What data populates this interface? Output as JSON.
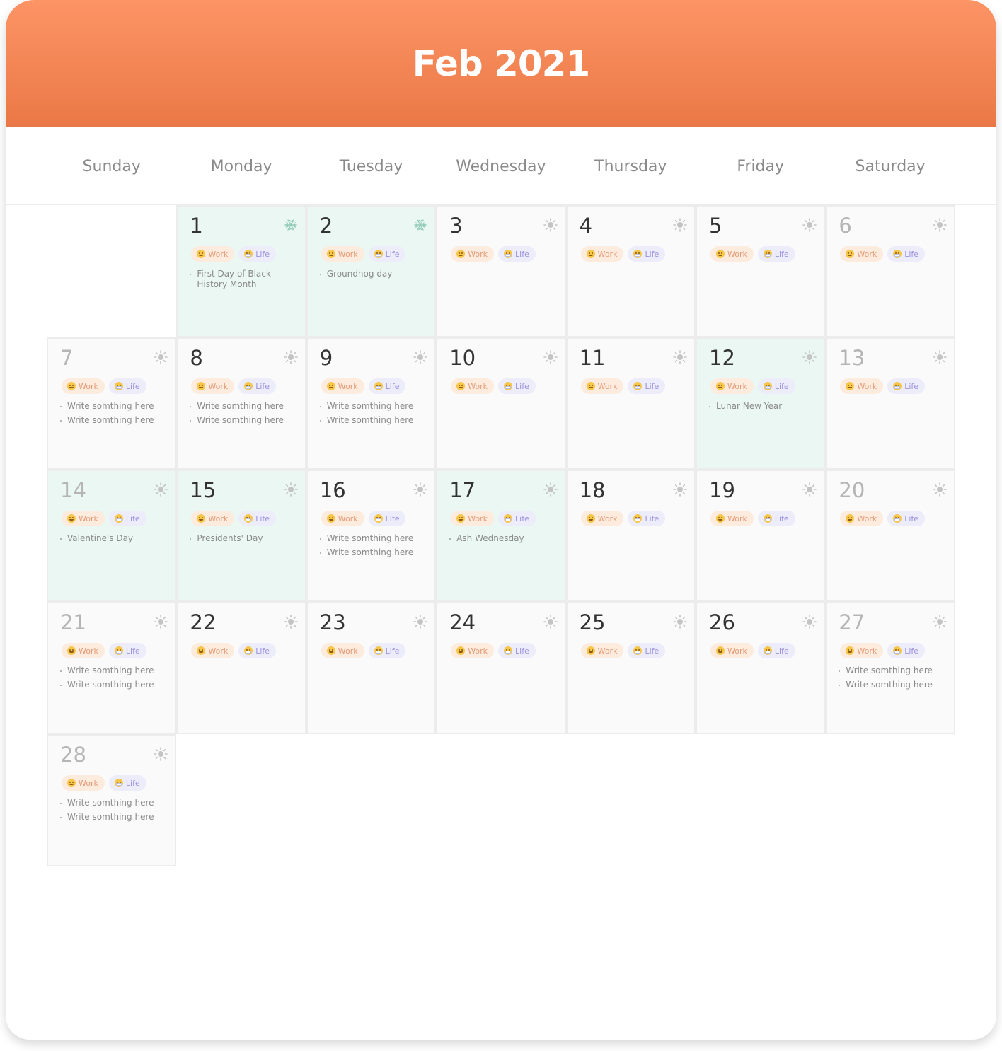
{
  "calendar": {
    "title": "Feb 2021",
    "weekdays": [
      "Sunday",
      "Monday",
      "Tuesday",
      "Wednesday",
      "Thursday",
      "Friday",
      "Saturday"
    ],
    "tags": {
      "work": "Work",
      "life": "Life"
    },
    "colors": {
      "header_top": "#fd9465",
      "header_bottom": "#ea7846",
      "holiday_bg": "#eaf7f2",
      "cell_bg": "#fafafa",
      "work_tag_bg": "#fdebdd",
      "life_tag_bg": "#ececfb"
    },
    "days": [
      {
        "day": "1",
        "weekday": 1,
        "week": 0,
        "holiday": true,
        "weather": "snowflake-icon",
        "notes": [
          "First Day of Black History Month"
        ]
      },
      {
        "day": "2",
        "weekday": 2,
        "week": 0,
        "holiday": true,
        "weather": "snowflake-icon",
        "notes": [
          "Groundhog day"
        ]
      },
      {
        "day": "3",
        "weekday": 3,
        "week": 0,
        "holiday": false,
        "weather": "sun-icon",
        "notes": []
      },
      {
        "day": "4",
        "weekday": 4,
        "week": 0,
        "holiday": false,
        "weather": "sun-icon",
        "notes": []
      },
      {
        "day": "5",
        "weekday": 5,
        "week": 0,
        "holiday": false,
        "weather": "sun-icon",
        "notes": []
      },
      {
        "day": "6",
        "weekday": 6,
        "week": 0,
        "holiday": false,
        "weather": "sun-icon",
        "notes": []
      },
      {
        "day": "7",
        "weekday": 0,
        "week": 1,
        "holiday": false,
        "weather": "sun-icon",
        "notes": [
          "Write somthing here",
          "Write somthing here"
        ]
      },
      {
        "day": "8",
        "weekday": 1,
        "week": 1,
        "holiday": false,
        "weather": "sun-icon",
        "notes": [
          "Write somthing here",
          "Write somthing here"
        ]
      },
      {
        "day": "9",
        "weekday": 2,
        "week": 1,
        "holiday": false,
        "weather": "sun-icon",
        "notes": [
          "Write somthing here",
          "Write somthing here"
        ]
      },
      {
        "day": "10",
        "weekday": 3,
        "week": 1,
        "holiday": false,
        "weather": "sun-icon",
        "notes": []
      },
      {
        "day": "11",
        "weekday": 4,
        "week": 1,
        "holiday": false,
        "weather": "sun-icon",
        "notes": []
      },
      {
        "day": "12",
        "weekday": 5,
        "week": 1,
        "holiday": true,
        "weather": "sun-icon",
        "notes": [
          "Lunar New Year"
        ]
      },
      {
        "day": "13",
        "weekday": 6,
        "week": 1,
        "holiday": false,
        "weather": "sun-icon",
        "notes": []
      },
      {
        "day": "14",
        "weekday": 0,
        "week": 2,
        "holiday": true,
        "weather": "sun-icon",
        "notes": [
          "Valentine's Day"
        ]
      },
      {
        "day": "15",
        "weekday": 1,
        "week": 2,
        "holiday": true,
        "weather": "sun-icon",
        "notes": [
          "Presidents' Day"
        ]
      },
      {
        "day": "16",
        "weekday": 2,
        "week": 2,
        "holiday": false,
        "weather": "sun-icon",
        "notes": [
          "Write somthing here",
          "Write somthing here"
        ]
      },
      {
        "day": "17",
        "weekday": 3,
        "week": 2,
        "holiday": true,
        "weather": "sun-icon",
        "notes": [
          "Ash Wednesday"
        ]
      },
      {
        "day": "18",
        "weekday": 4,
        "week": 2,
        "holiday": false,
        "weather": "sun-icon",
        "notes": []
      },
      {
        "day": "19",
        "weekday": 5,
        "week": 2,
        "holiday": false,
        "weather": "sun-icon",
        "notes": []
      },
      {
        "day": "20",
        "weekday": 6,
        "week": 2,
        "holiday": false,
        "weather": "sun-icon",
        "notes": []
      },
      {
        "day": "21",
        "weekday": 0,
        "week": 3,
        "holiday": false,
        "weather": "sun-icon",
        "notes": [
          "Write somthing here",
          "Write somthing here"
        ]
      },
      {
        "day": "22",
        "weekday": 1,
        "week": 3,
        "holiday": false,
        "weather": "sun-icon",
        "notes": []
      },
      {
        "day": "23",
        "weekday": 2,
        "week": 3,
        "holiday": false,
        "weather": "sun-icon",
        "notes": []
      },
      {
        "day": "24",
        "weekday": 3,
        "week": 3,
        "holiday": false,
        "weather": "sun-icon",
        "notes": []
      },
      {
        "day": "25",
        "weekday": 4,
        "week": 3,
        "holiday": false,
        "weather": "sun-icon",
        "notes": []
      },
      {
        "day": "26",
        "weekday": 5,
        "week": 3,
        "holiday": false,
        "weather": "sun-icon",
        "notes": []
      },
      {
        "day": "27",
        "weekday": 6,
        "week": 3,
        "holiday": false,
        "weather": "sun-icon",
        "notes": [
          "Write somthing here",
          "Write somthing here"
        ]
      },
      {
        "day": "28",
        "weekday": 0,
        "week": 4,
        "holiday": false,
        "weather": "sun-icon",
        "notes": [
          "Write somthing here",
          "Write somthing here"
        ]
      }
    ]
  }
}
